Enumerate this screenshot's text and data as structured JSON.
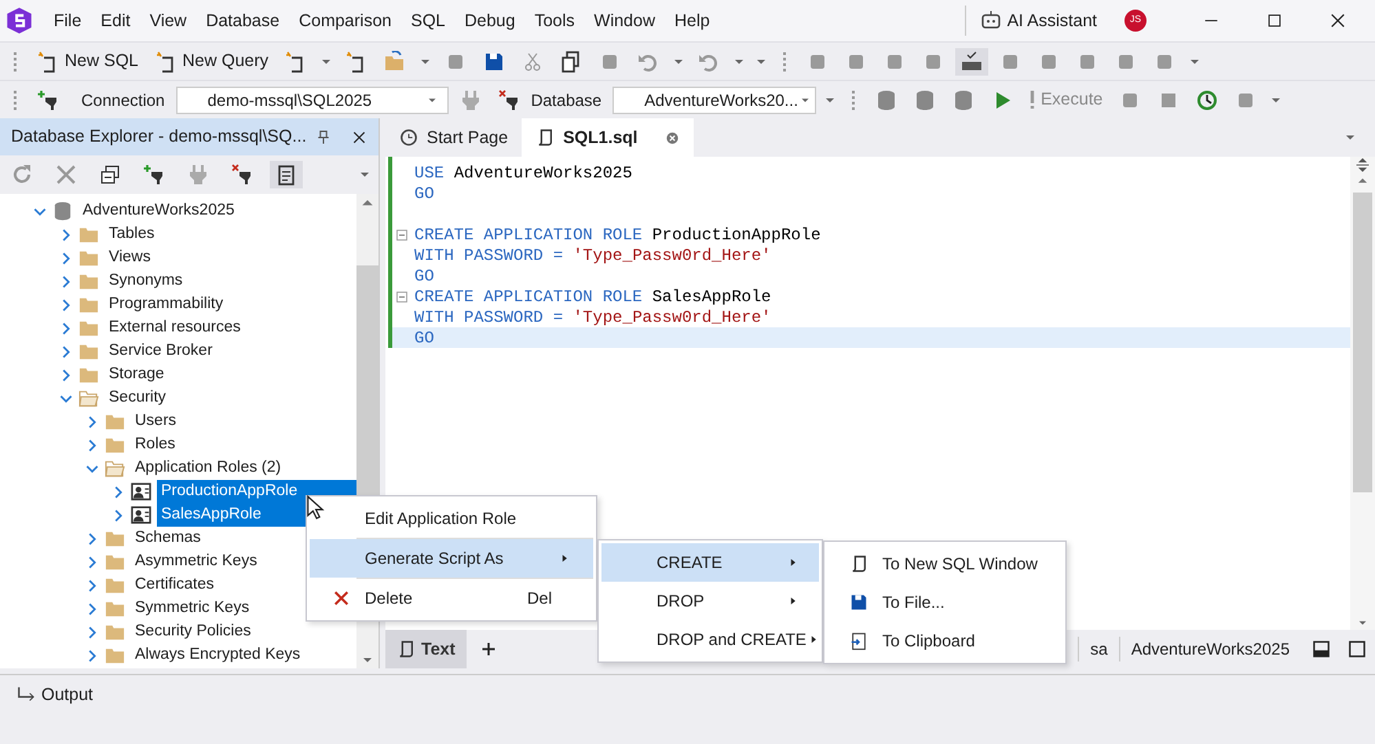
{
  "menu_bar": {
    "items": [
      "File",
      "Edit",
      "View",
      "Database",
      "Comparison",
      "SQL",
      "Debug",
      "Tools",
      "Window",
      "Help"
    ],
    "ai_assistant": "AI Assistant",
    "avatar": "JS"
  },
  "toolbar": {
    "new_sql": "New SQL",
    "new_query": "New Query",
    "format_sql_pressed": true
  },
  "connection_bar": {
    "connection_label": "Connection",
    "connection": "demo-mssql\\SQL2025",
    "database_label": "Database",
    "database": "AdventureWorks20...",
    "execute": "Execute"
  },
  "explorer": {
    "title": "Database Explorer - demo-mssql\\SQ...",
    "tree": [
      {
        "label": "AdventureWorks2025",
        "kind": "database",
        "expanded": true,
        "selected": false,
        "children": [
          {
            "label": "Tables",
            "kind": "folder",
            "expanded": false,
            "selected": false
          },
          {
            "label": "Views",
            "kind": "folder",
            "expanded": false,
            "selected": false
          },
          {
            "label": "Synonyms",
            "kind": "folder",
            "expanded": false,
            "selected": false
          },
          {
            "label": "Programmability",
            "kind": "folder",
            "expanded": false,
            "selected": false
          },
          {
            "label": "External resources",
            "kind": "folder",
            "expanded": false,
            "selected": false
          },
          {
            "label": "Service Broker",
            "kind": "folder",
            "expanded": false,
            "selected": false
          },
          {
            "label": "Storage",
            "kind": "folder",
            "expanded": false,
            "selected": false
          },
          {
            "label": "Security",
            "kind": "folder",
            "expanded": true,
            "selected": false,
            "children": [
              {
                "label": "Users",
                "kind": "folder",
                "expanded": false,
                "selected": false
              },
              {
                "label": "Roles",
                "kind": "folder",
                "expanded": false,
                "selected": false
              },
              {
                "label": "Application Roles (2)",
                "kind": "folder",
                "expanded": true,
                "selected": false,
                "children": [
                  {
                    "label": "ProductionAppRole",
                    "kind": "role",
                    "expanded": false,
                    "selected": true
                  },
                  {
                    "label": "SalesAppRole",
                    "kind": "role",
                    "expanded": false,
                    "selected": true
                  }
                ]
              },
              {
                "label": "Schemas",
                "kind": "folder",
                "expanded": false,
                "selected": false
              },
              {
                "label": "Asymmetric Keys",
                "kind": "folder",
                "expanded": false,
                "selected": false
              },
              {
                "label": "Certificates",
                "kind": "folder",
                "expanded": false,
                "selected": false
              },
              {
                "label": "Symmetric Keys",
                "kind": "folder",
                "expanded": false,
                "selected": false
              },
              {
                "label": "Security Policies",
                "kind": "folder",
                "expanded": false,
                "selected": false
              },
              {
                "label": "Always Encrypted Keys",
                "kind": "folder",
                "expanded": false,
                "selected": false
              }
            ]
          }
        ]
      }
    ]
  },
  "tabs": [
    {
      "label": "Start Page",
      "kind": "start",
      "selected": false
    },
    {
      "label": "SQL1.sql",
      "kind": "sql",
      "selected": true
    }
  ],
  "editor": {
    "lines": [
      {
        "fold": false,
        "current": false,
        "tokens": [
          {
            "kind": "keyword",
            "text": "USE"
          },
          {
            "kind": "ident",
            "text": "AdventureWorks2025"
          }
        ]
      },
      {
        "fold": false,
        "current": false,
        "tokens": [
          {
            "kind": "keyword",
            "text": "GO"
          }
        ]
      },
      {
        "fold": false,
        "current": false
      },
      {
        "fold": true,
        "current": false,
        "tokens": [
          {
            "kind": "keyword",
            "text": "CREATE APPLICATION ROLE"
          },
          {
            "kind": "ident",
            "text": "ProductionAppRole"
          }
        ]
      },
      {
        "fold": false,
        "current": false,
        "tokens": [
          {
            "kind": "keyword",
            "text": "WITH PASSWORD ="
          },
          {
            "kind": "string",
            "text": "'Type_Passw0rd_Here'"
          }
        ]
      },
      {
        "fold": false,
        "current": false,
        "tokens": [
          {
            "kind": "keyword",
            "text": "GO"
          }
        ]
      },
      {
        "fold": true,
        "current": false,
        "tokens": [
          {
            "kind": "keyword",
            "text": "CREATE APPLICATION ROLE"
          },
          {
            "kind": "ident",
            "text": "SalesAppRole"
          }
        ]
      },
      {
        "fold": false,
        "current": false,
        "tokens": [
          {
            "kind": "keyword",
            "text": "WITH PASSWORD ="
          },
          {
            "kind": "string",
            "text": "'Type_Passw0rd_Here'"
          }
        ]
      },
      {
        "fold": false,
        "current": true,
        "tokens": [
          {
            "kind": "keyword",
            "text": "GO"
          }
        ]
      }
    ]
  },
  "editor_bottom": {
    "tabs": [
      {
        "label": "Text",
        "selected": true
      }
    ],
    "status": [
      "sa",
      "AdventureWorks2025"
    ]
  },
  "context_menu": [
    {
      "label": "Edit Application Role",
      "kind": "item",
      "selected": false
    },
    {
      "label": "Generate Script As",
      "kind": "submenu",
      "selected": true
    },
    {
      "label": "Delete",
      "kind": "delete",
      "shortcut": "Del",
      "selected": false
    }
  ],
  "script_submenu": [
    {
      "label": "CREATE",
      "selected": true
    },
    {
      "label": "DROP",
      "selected": false
    },
    {
      "label": "DROP and CREATE",
      "selected": false
    }
  ],
  "target_submenu": [
    {
      "label": "To New SQL Window",
      "kind": "sql"
    },
    {
      "label": "To File...",
      "kind": "file"
    },
    {
      "label": "To Clipboard",
      "kind": "clipboard"
    }
  ],
  "output_bar": {
    "label": "Output"
  }
}
